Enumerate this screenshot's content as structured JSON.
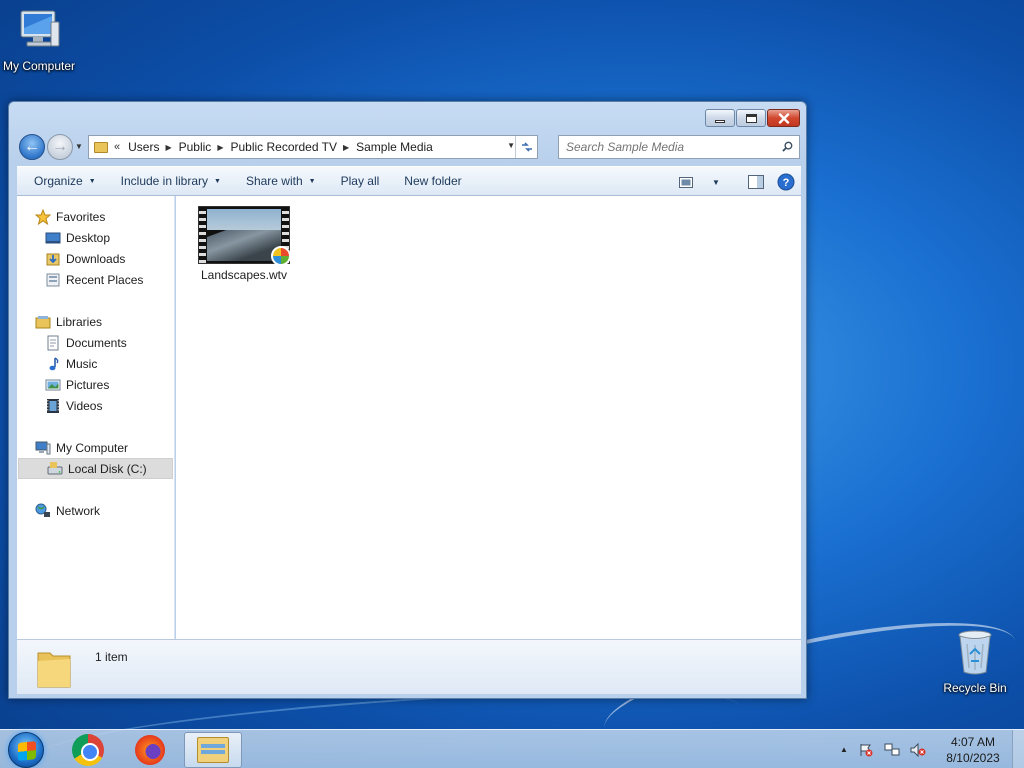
{
  "desktop": {
    "icons": [
      {
        "label": "My Computer"
      },
      {
        "label": "Recycle Bin"
      }
    ]
  },
  "window": {
    "address": {
      "overflow_glyph": "«",
      "crumbs": [
        "Users",
        "Public",
        "Public Recorded TV",
        "Sample Media"
      ]
    },
    "search": {
      "placeholder": "Search Sample Media"
    },
    "toolbar": {
      "organize": "Organize",
      "include_in_library": "Include in library",
      "share_with": "Share with",
      "play_all": "Play all",
      "new_folder": "New folder"
    },
    "nav": {
      "favorites": "Favorites",
      "desktop": "Desktop",
      "downloads": "Downloads",
      "recent_places": "Recent Places",
      "libraries": "Libraries",
      "documents": "Documents",
      "music": "Music",
      "pictures": "Pictures",
      "videos": "Videos",
      "my_computer": "My Computer",
      "local_disk": "Local Disk (C:)",
      "network": "Network"
    },
    "files": [
      {
        "name": "Landscapes.wtv"
      }
    ],
    "details": {
      "count": "1 item"
    }
  },
  "taskbar": {
    "clock": {
      "time": "4:07 AM",
      "date": "8/10/2023"
    }
  },
  "colors": {
    "wallpaper": "#1a6fd0",
    "toolbar_text": "#1e395b",
    "close_button": "#d1482f",
    "selection": "#dcdcdc"
  }
}
